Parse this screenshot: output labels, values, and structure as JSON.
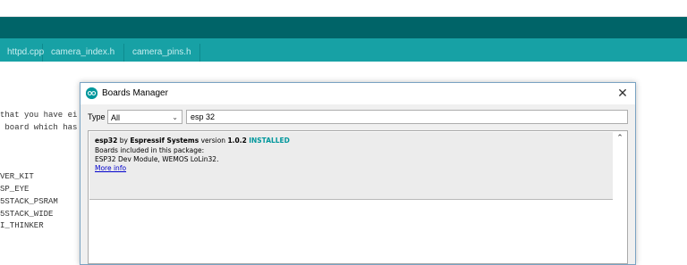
{
  "ide": {
    "tabs": [
      "httpd.cpp",
      "camera_index.h",
      "camera_pins.h"
    ]
  },
  "editor": {
    "lines": [
      "that you have ei",
      " board which has",
      "VER_KIT",
      "SP_EYE",
      "5STACK_PSRAM",
      "5STACK_WIDE",
      "I_THINKER"
    ]
  },
  "dialog": {
    "title": "Boards Manager",
    "close_glyph": "✕",
    "type_label": "Type",
    "type_value": "All",
    "search_value": "esp 32",
    "package": {
      "name": "esp32",
      "by": "by",
      "author": "Espressif Systems",
      "version_label": "version",
      "version": "1.0.2",
      "status": "INSTALLED",
      "included_label": "Boards included in this package:",
      "boards": "ESP32 Dev Module, WEMOS LoLin32.",
      "more_info": "More info"
    }
  },
  "colors": {
    "toolbar": "#006468",
    "tabbar": "#17a1a5",
    "accent": "#00979c"
  }
}
